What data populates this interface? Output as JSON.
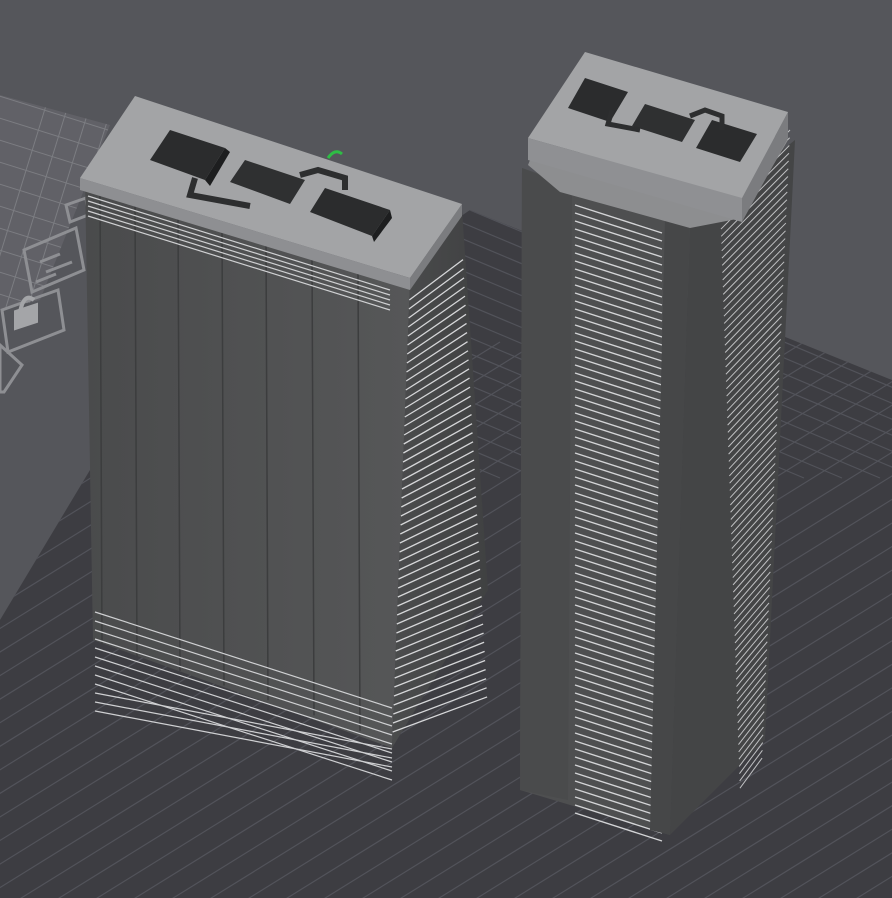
{
  "viewport": {
    "background": "#55565b",
    "bed_color": "#3d3d42",
    "grid_color": "#52535a",
    "model_color": "#4a4b4c",
    "roof_color": "#a3a4a6"
  },
  "models": [
    {
      "name": "tower-left"
    },
    {
      "name": "tower-right"
    }
  ],
  "gizmos": [
    {
      "name": "lock-icon"
    },
    {
      "name": "layer-plan-icon"
    }
  ]
}
